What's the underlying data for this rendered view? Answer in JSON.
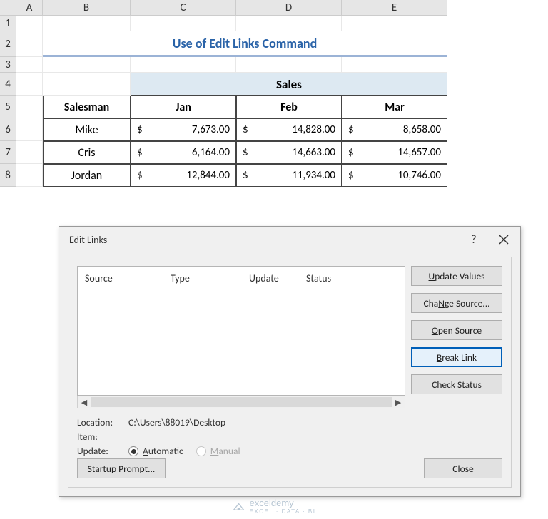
{
  "columns": [
    "A",
    "B",
    "C",
    "D",
    "E"
  ],
  "rows": [
    "1",
    "2",
    "3",
    "4",
    "5",
    "6",
    "7",
    "8"
  ],
  "title": "Use of Edit Links Command",
  "table": {
    "sales_header": "Sales",
    "salesman_header": "Salesman",
    "months": [
      "Jan",
      "Feb",
      "Mar"
    ],
    "rows": [
      {
        "name": "Mike",
        "vals": [
          "7,673.00",
          "14,828.00",
          "8,658.00"
        ]
      },
      {
        "name": "Cris",
        "vals": [
          "6,164.00",
          "14,663.00",
          "14,657.00"
        ]
      },
      {
        "name": "Jordan",
        "vals": [
          "12,844.00",
          "11,934.00",
          "10,746.00"
        ]
      }
    ],
    "currency": "$"
  },
  "dialog": {
    "title": "Edit Links",
    "help": "?",
    "list_headers": {
      "source": "Source",
      "type": "Type",
      "update": "Update",
      "status": "Status"
    },
    "buttons": {
      "update_values": "Update Values",
      "change_source": "Change Source...",
      "open_source": "Open Source",
      "break_link": "Break Link",
      "check_status": "Check Status",
      "startup": "Startup Prompt...",
      "close": "Close"
    },
    "underlines": {
      "update_values": "U",
      "change_source": "N",
      "open_source": "O",
      "break_link": "B",
      "check_status": "C",
      "startup": "S",
      "close": "l",
      "automatic": "A",
      "manual": "M"
    },
    "info": {
      "location_label": "Location:",
      "location_value": "C:\\Users\\88019\\Desktop",
      "item_label": "Item:",
      "update_label": "Update:",
      "automatic": "Automatic",
      "manual": "Manual"
    }
  },
  "watermark": {
    "brand": "exceldemy",
    "sub": "EXCEL · DATA · BI"
  }
}
